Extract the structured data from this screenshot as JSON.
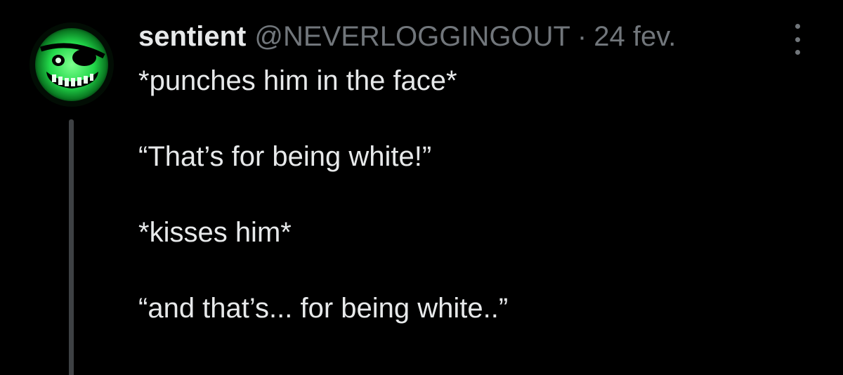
{
  "author": {
    "display_name": "sentient",
    "handle": "@NEVERLOGGINGOUT",
    "separator": "·",
    "date": "24 fev.",
    "avatar_icon": "green-grinning-pirate-face-icon"
  },
  "tweet": {
    "lines": [
      "*punches him in the face*",
      "“That’s for being white!”",
      "*kisses him*",
      "“and that’s... for being white..”"
    ]
  },
  "colors": {
    "background": "#000000",
    "text_primary": "#e7e9ea",
    "text_secondary": "#71767b",
    "thread_line": "#3e4144",
    "avatar_green": "#22d84a"
  },
  "actions": {
    "more_icon": "more-options-icon"
  }
}
